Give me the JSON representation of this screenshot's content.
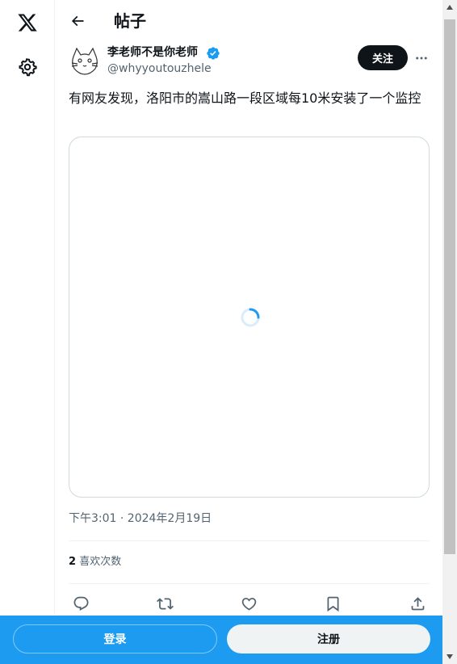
{
  "header": {
    "title": "帖子"
  },
  "author": {
    "name": "李老师不是你老师",
    "handle": "@whyyoutouzhele",
    "follow_label": "关注"
  },
  "post": {
    "text": "有网友发现，洛阳市的嵩山路一段区域每10米安装了一个监控",
    "timestamp": "下午3:01 · 2024年2月19日",
    "likes_count": "2",
    "likes_label": "喜欢次数"
  },
  "bottom_bar": {
    "login_label": "登录",
    "signup_label": "注册"
  },
  "colors": {
    "accent": "#1d9bf0",
    "text_primary": "#0f1419",
    "text_secondary": "#536471",
    "follow_button": "#0f1419"
  },
  "icons": {
    "logo": "x-logo-icon",
    "settings": "gear-icon",
    "back": "arrow-left-icon",
    "verified": "verified-badge-icon",
    "more": "more-horizontal-icon",
    "loading": "loading-spinner-icon",
    "reply": "reply-icon",
    "retweet": "retweet-icon",
    "like": "heart-icon",
    "bookmark": "bookmark-icon",
    "share": "share-icon"
  }
}
